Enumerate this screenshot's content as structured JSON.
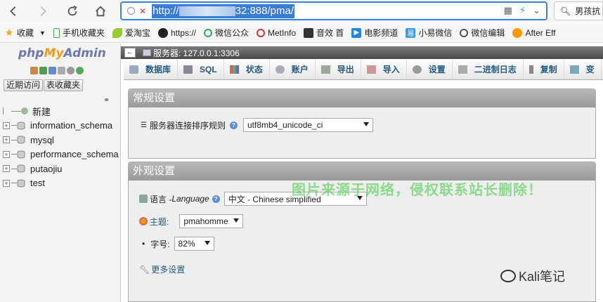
{
  "browser": {
    "url_prefix": "http://",
    "url_suffix": "32:888/pma/",
    "search_text": "男孩抗"
  },
  "bookmarks": [
    "收藏",
    "手机收藏夹",
    "爱淘宝",
    "https://",
    "微信公众",
    "MetInfo",
    "音效 首",
    "电影频道",
    "小易微信",
    "微信编辑",
    "After Eff"
  ],
  "sidebar": {
    "logo_php": "php",
    "logo_my": "My",
    "logo_admin": "Admin",
    "recent_btn": "近期访问",
    "favorites_btn": "表收藏夹",
    "tree": [
      "新建",
      "information_schema",
      "mysql",
      "performance_schema",
      "putaojiu",
      "test"
    ]
  },
  "server": {
    "title": "服务器: 127.0.0.1:3306"
  },
  "tabs": [
    "数据库",
    "SQL",
    "状态",
    "账户",
    "导出",
    "导入",
    "设置",
    "二进制日志",
    "复制",
    "变"
  ],
  "general": {
    "title": "常规设置",
    "collation_label": "服务器连接排序规则",
    "collation_value": "utf8mb4_unicode_ci"
  },
  "appearance": {
    "title": "外观设置",
    "language_label": "语言 - ",
    "language_en": "Language",
    "language_value": "中文 - Chinese simplified",
    "theme_label": "主题:",
    "theme_value": "pmahomme",
    "fontsize_label": "字号:",
    "fontsize_value": "82%",
    "more_settings": "更多设置"
  },
  "watermark": "图片来源于网络，侵权联系站长删除！",
  "brand": "Kali笔记"
}
